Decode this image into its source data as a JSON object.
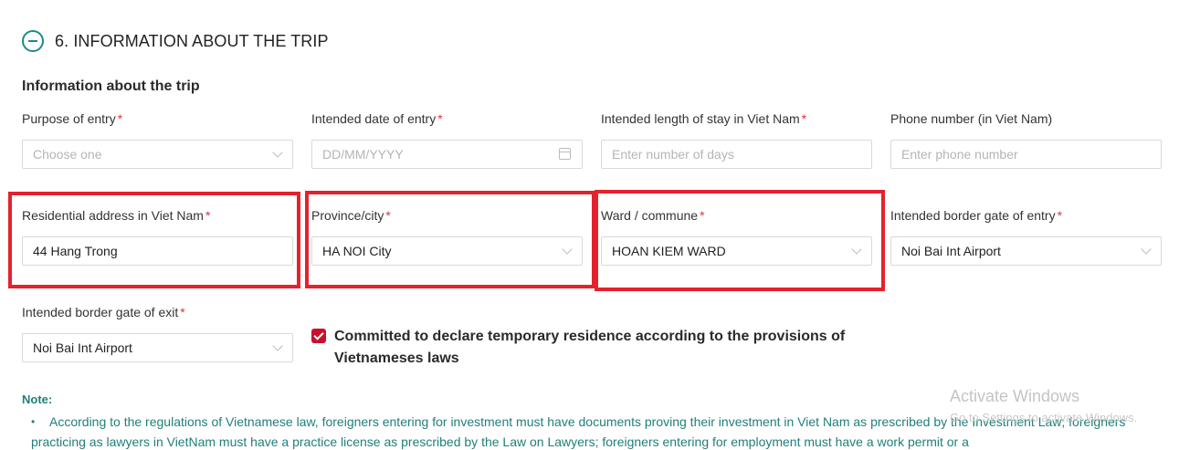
{
  "section": {
    "title": "6. INFORMATION ABOUT THE TRIP"
  },
  "subheading": "Information about the trip",
  "fields": {
    "purpose": {
      "label": "Purpose of entry",
      "required": "*",
      "placeholder": "Choose one"
    },
    "entry_date": {
      "label": "Intended date of entry",
      "required": "*",
      "placeholder": "DD/MM/YYYY"
    },
    "stay_length": {
      "label": "Intended length of stay in Viet Nam",
      "required": "*",
      "placeholder": "Enter number of days"
    },
    "phone": {
      "label": "Phone number (in Viet Nam)",
      "placeholder": "Enter phone number"
    },
    "address": {
      "label": "Residential address in Viet Nam",
      "required": "*",
      "value": "44 Hang Trong"
    },
    "province": {
      "label": "Province/city",
      "required": "*",
      "value": "HA NOI City"
    },
    "ward": {
      "label": "Ward / commune",
      "required": "*",
      "value": "HOAN KIEM WARD"
    },
    "gate_entry": {
      "label": "Intended border gate of entry",
      "required": "*",
      "value": "Noi Bai Int Airport"
    },
    "gate_exit": {
      "label": "Intended border gate of exit",
      "required": "*",
      "value": "Noi Bai Int Airport"
    }
  },
  "commitment": {
    "checked": true,
    "line1": "Committed to declare temporary residence according to the provisions of",
    "line2": "Vietnameses laws"
  },
  "note": {
    "label": "Note:",
    "bullet": "•",
    "text": "According to the regulations of Vietnamese law, foreigners entering for investment must have documents proving their investment in Viet Nam as prescribed by the Investment Law; foreigners practicing as lawyers in VietNam must have a practice license as prescribed by the Law on Lawyers; foreigners entering for employment must have a work permit or a"
  },
  "watermark": {
    "title": "Activate Windows",
    "subtitle": "Go to Settings to activate Windows."
  },
  "colors": {
    "accent": "#1f8a86",
    "required": "#e0323a",
    "highlight": "#e4222d",
    "checkbox": "#c8102e"
  }
}
